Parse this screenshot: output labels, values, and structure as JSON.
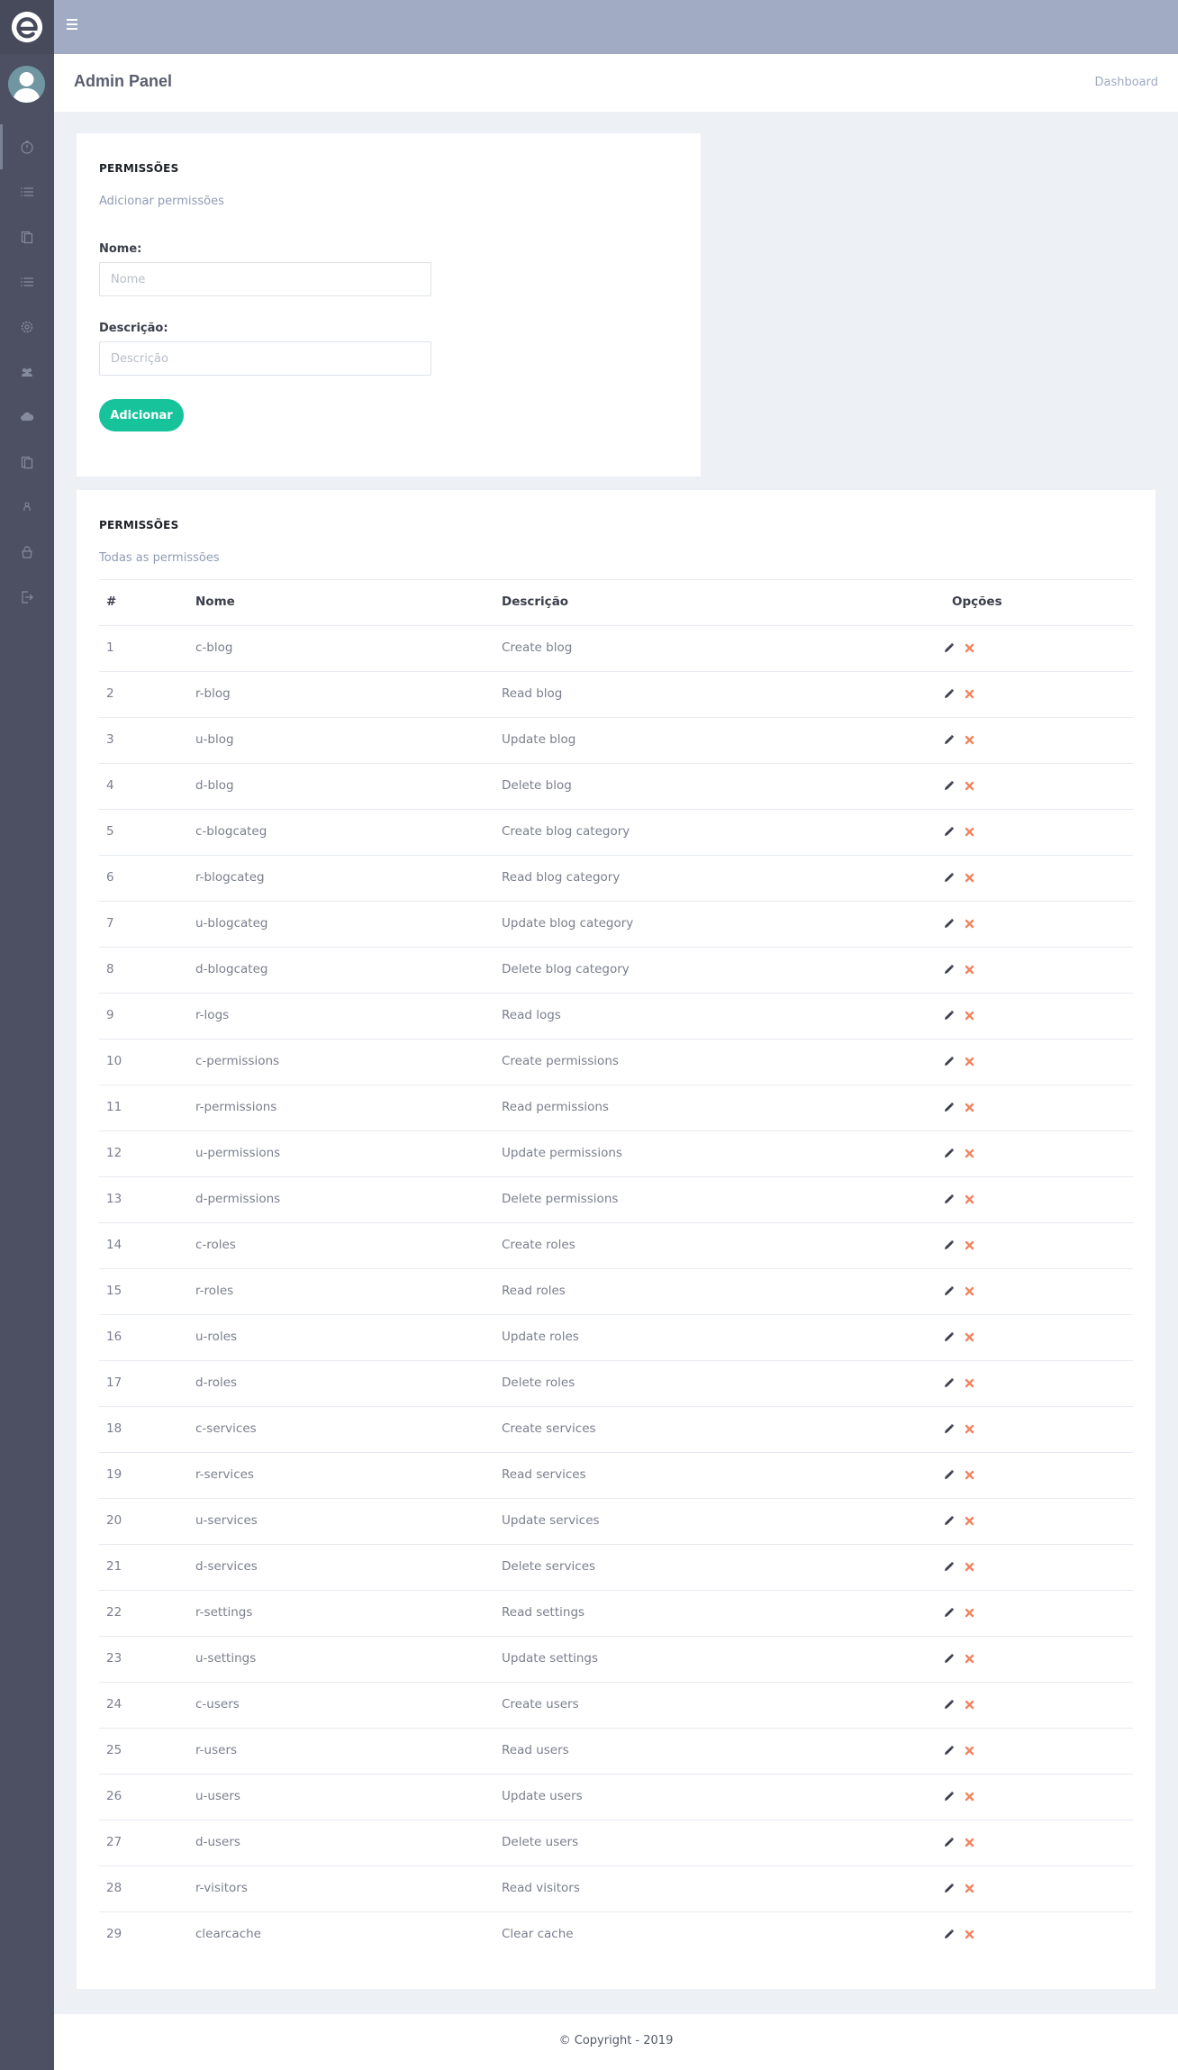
{
  "brand": {
    "logo": "e-logo-icon"
  },
  "topbar": {
    "menu_icon": "hamburger-icon"
  },
  "sidebar": {
    "items": [
      {
        "icon": "dashboard-gauge-icon"
      },
      {
        "icon": "list-icon"
      },
      {
        "icon": "clipboard-icon"
      },
      {
        "icon": "list-icon"
      },
      {
        "icon": "settings-gear-icon"
      },
      {
        "icon": "users-icon"
      },
      {
        "icon": "cloud-icon"
      },
      {
        "icon": "clipboard-icon"
      },
      {
        "icon": "user-icon"
      },
      {
        "icon": "lock-icon"
      },
      {
        "icon": "sign-out-icon"
      }
    ]
  },
  "header": {
    "title": "Admin Panel",
    "breadcrumb": "Dashboard"
  },
  "form": {
    "title": "PERMISSÕES",
    "subtitle": "Adicionar permissões",
    "name_label": "Nome:",
    "name_placeholder": "Nome",
    "desc_label": "Descrição:",
    "desc_placeholder": "Descrição",
    "submit_label": "Adicionar"
  },
  "table": {
    "title": "PERMISSÕES",
    "subtitle": "Todas as permissões",
    "headers": {
      "id": "#",
      "name": "Nome",
      "desc": "Descrição",
      "options": "Opções"
    },
    "rows": [
      {
        "id": "1",
        "name": "c-blog",
        "desc": "Create blog"
      },
      {
        "id": "2",
        "name": "r-blog",
        "desc": "Read blog"
      },
      {
        "id": "3",
        "name": "u-blog",
        "desc": "Update blog"
      },
      {
        "id": "4",
        "name": "d-blog",
        "desc": "Delete blog"
      },
      {
        "id": "5",
        "name": "c-blogcateg",
        "desc": "Create blog category"
      },
      {
        "id": "6",
        "name": "r-blogcateg",
        "desc": "Read blog category"
      },
      {
        "id": "7",
        "name": "u-blogcateg",
        "desc": "Update blog category"
      },
      {
        "id": "8",
        "name": "d-blogcateg",
        "desc": "Delete blog category"
      },
      {
        "id": "9",
        "name": "r-logs",
        "desc": "Read logs"
      },
      {
        "id": "10",
        "name": "c-permissions",
        "desc": "Create permissions"
      },
      {
        "id": "11",
        "name": "r-permissions",
        "desc": "Read permissions"
      },
      {
        "id": "12",
        "name": "u-permissions",
        "desc": "Update permissions"
      },
      {
        "id": "13",
        "name": "d-permissions",
        "desc": "Delete permissions"
      },
      {
        "id": "14",
        "name": "c-roles",
        "desc": "Create roles"
      },
      {
        "id": "15",
        "name": "r-roles",
        "desc": "Read roles"
      },
      {
        "id": "16",
        "name": "u-roles",
        "desc": "Update roles"
      },
      {
        "id": "17",
        "name": "d-roles",
        "desc": "Delete roles"
      },
      {
        "id": "18",
        "name": "c-services",
        "desc": "Create services"
      },
      {
        "id": "19",
        "name": "r-services",
        "desc": "Read services"
      },
      {
        "id": "20",
        "name": "u-services",
        "desc": "Update services"
      },
      {
        "id": "21",
        "name": "d-services",
        "desc": "Delete services"
      },
      {
        "id": "22",
        "name": "r-settings",
        "desc": "Read settings"
      },
      {
        "id": "23",
        "name": "u-settings",
        "desc": "Update settings"
      },
      {
        "id": "24",
        "name": "c-users",
        "desc": "Create users"
      },
      {
        "id": "25",
        "name": "r-users",
        "desc": "Read users"
      },
      {
        "id": "26",
        "name": "u-users",
        "desc": "Update users"
      },
      {
        "id": "27",
        "name": "d-users",
        "desc": "Delete users"
      },
      {
        "id": "28",
        "name": "r-visitors",
        "desc": "Read visitors"
      },
      {
        "id": "29",
        "name": "clearcache",
        "desc": "Clear cache"
      }
    ],
    "edit_icon": "pencil-icon",
    "delete_icon": "close-x-icon"
  },
  "footer": {
    "copyright": "© Copyright - 2019"
  },
  "colors": {
    "sidebar": "#4c5062",
    "topbar": "#a1acc4",
    "accent": "#16c39b",
    "delete": "#f0845f",
    "muted": "#8f9bb5"
  }
}
